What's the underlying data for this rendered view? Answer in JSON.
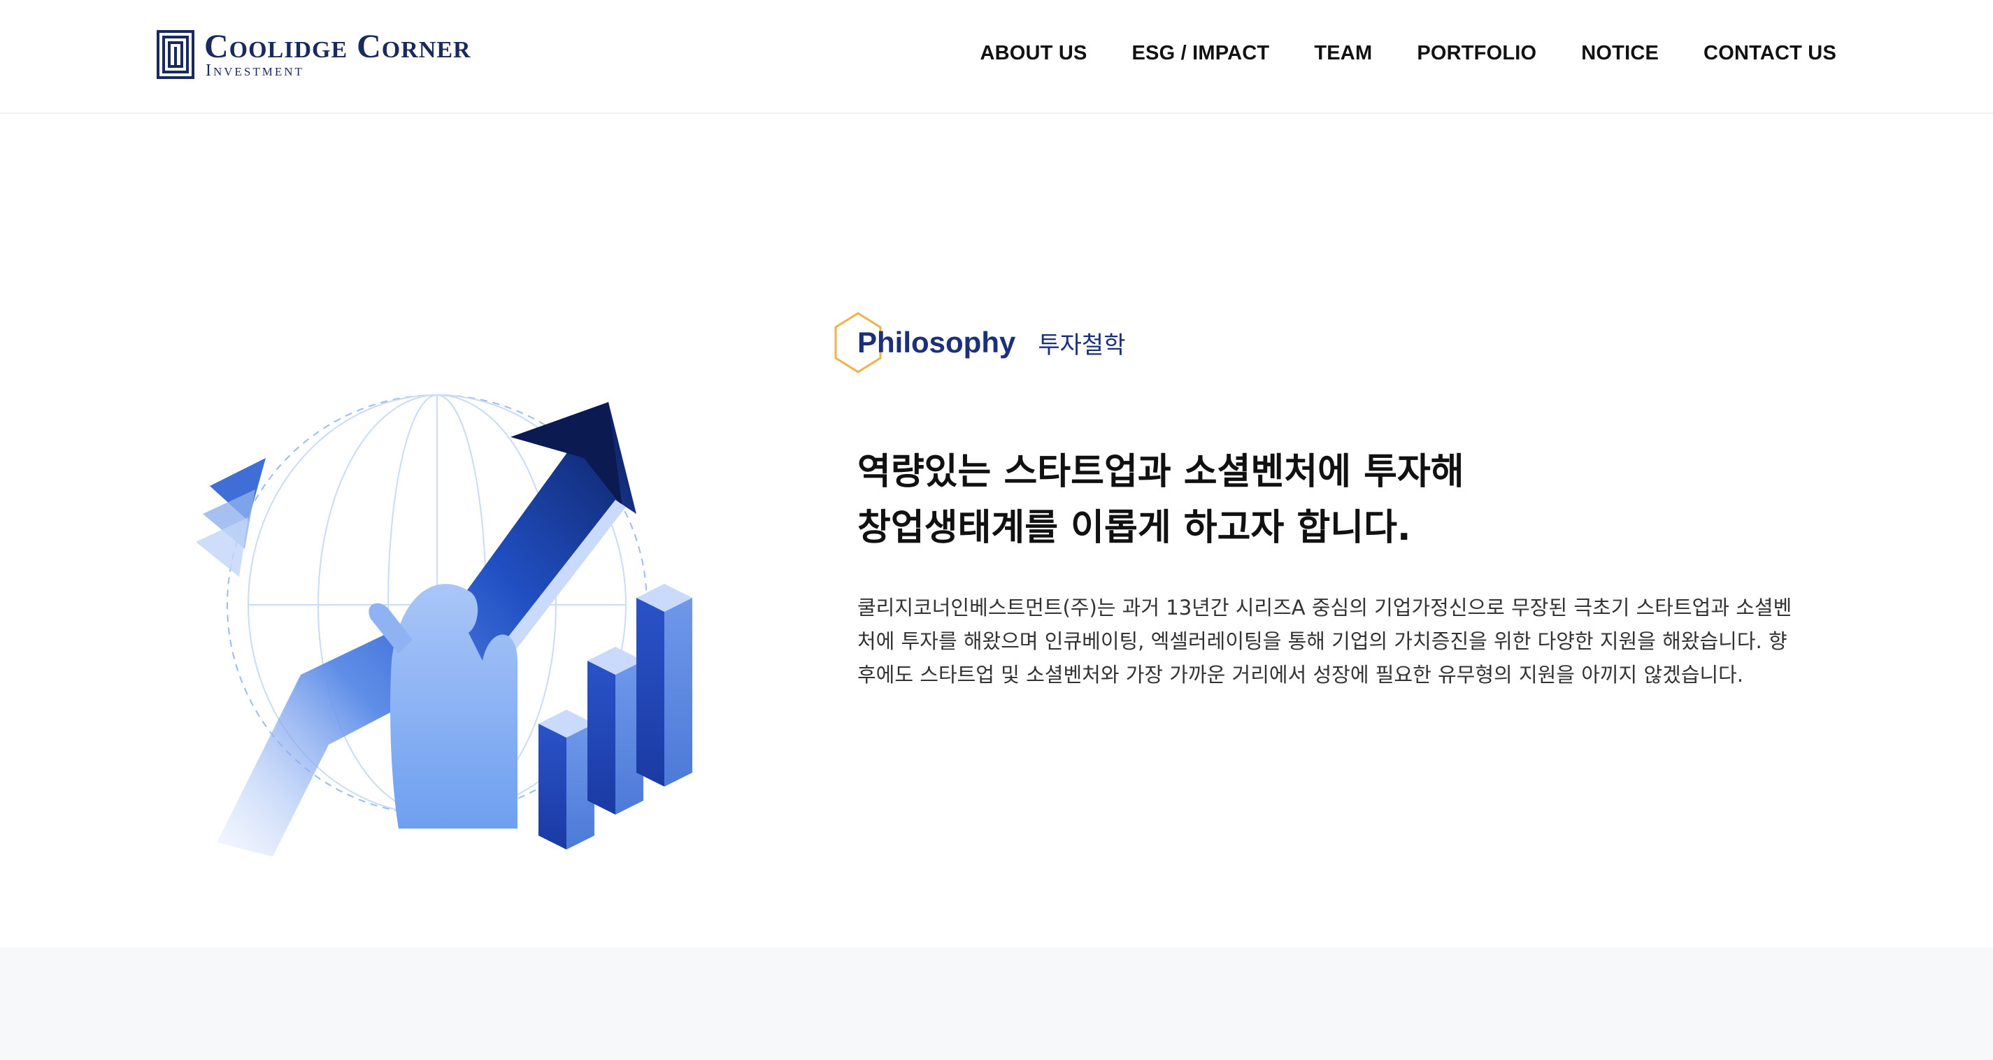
{
  "header": {
    "logo_main": "Coolidge Corner",
    "logo_sub": "Investment",
    "nav": [
      {
        "label": "ABOUT US"
      },
      {
        "label": "ESG / IMPACT"
      },
      {
        "label": "TEAM"
      },
      {
        "label": "PORTFOLIO"
      },
      {
        "label": "NOTICE"
      },
      {
        "label": "CONTACT US"
      }
    ]
  },
  "philosophy": {
    "label_en": "Philosophy",
    "label_ko": "투자철학",
    "headline_line1": "역량있는 스타트업과 소셜벤처에 투자해",
    "headline_line2": "창업생태계를 이롭게 하고자 합니다.",
    "description": "쿨리지코너인베스트먼트(주)는 과거 13년간 시리즈A 중심의 기업가정신으로 무장된 극초기 스타트업과 소셜벤처에 투자를 해왔으며 인큐베이팅, 엑셀러레이팅을 통해 기업의 가치증진을 위한 다양한 지원을 해왔습니다. 향후에도 스타트업 및 소셜벤처와 가장 가까운 거리에서 성장에 필요한 유무형의 지원을 아끼지 않겠습니다."
  },
  "colors": {
    "brand_navy": "#1b2a5c",
    "accent_blue": "#1b2f7a",
    "hexagon_orange": "#f0b24a",
    "band_gray": "#f7f8fa"
  },
  "icons": {
    "logo": "logo-mark-icon",
    "illustration": "growth-chart-illustration",
    "label_decoration": "hexagon-icon"
  }
}
